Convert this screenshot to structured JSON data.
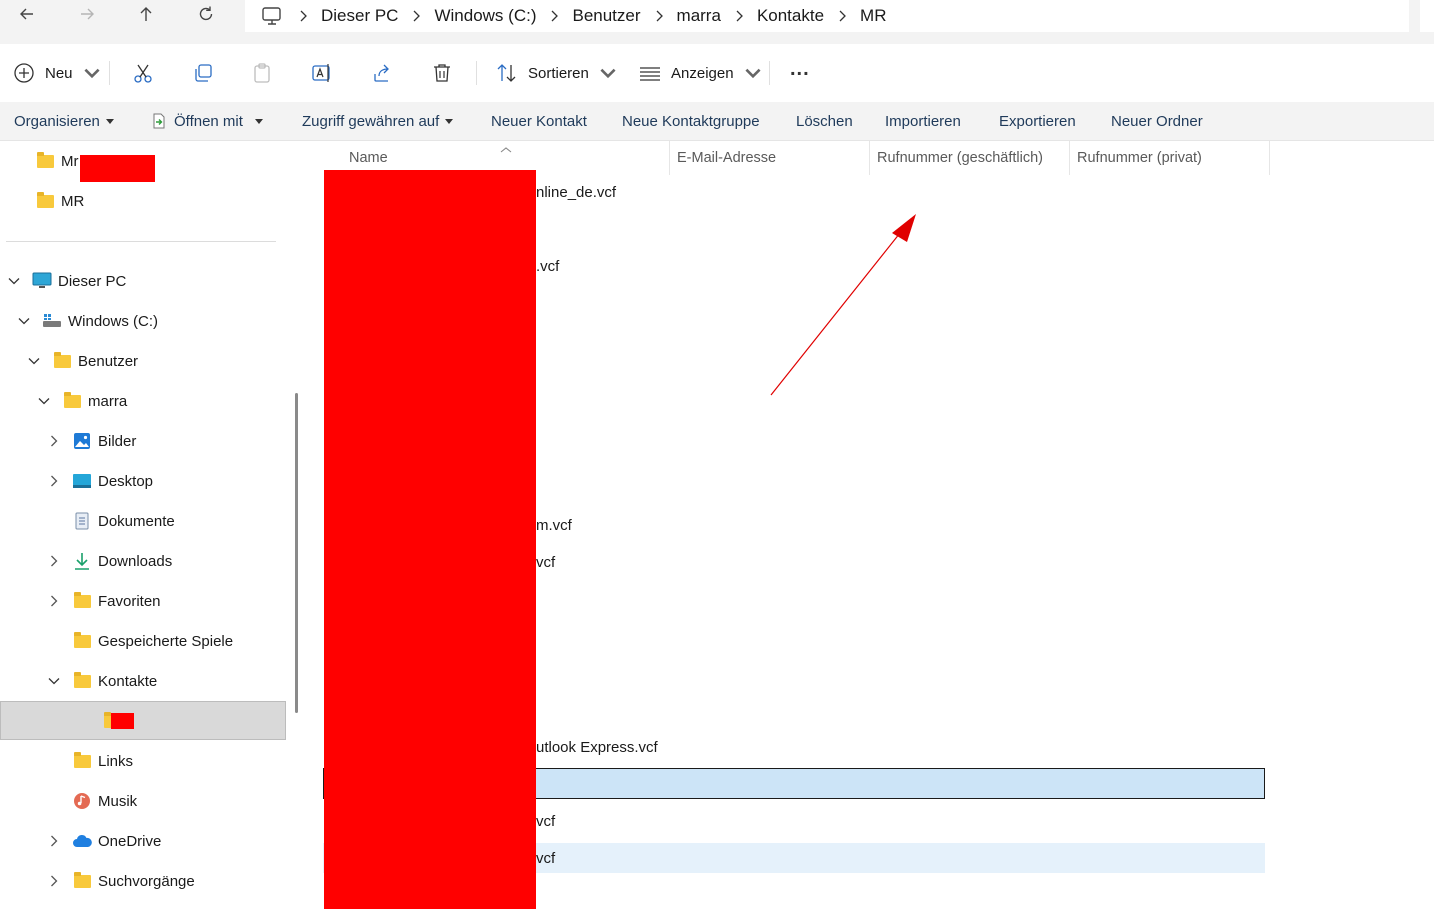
{
  "breadcrumb": [
    "Dieser PC",
    "Windows (C:)",
    "Benutzer",
    "marra",
    "Kontakte",
    "MR"
  ],
  "toolbar": {
    "new_label": "Neu",
    "sort_label": "Sortieren",
    "view_label": "Anzeigen",
    "more_label": "..."
  },
  "ribbon": [
    "Organisieren",
    "Öffnen mit",
    "Zugriff gewähren auf",
    "Neuer Kontakt",
    "Neue Kontaktgruppe",
    "Löschen",
    "Importieren",
    "Exportieren",
    "Neuer Ordner"
  ],
  "nav": {
    "quick": [
      "Mr",
      "MR"
    ],
    "tree": [
      "Dieser PC",
      "Windows (C:)",
      "Benutzer",
      "marra",
      "Bilder",
      "Desktop",
      "Dokumente",
      "Downloads",
      "Favoriten",
      "Gespeicherte Spiele",
      "Kontakte",
      "Links",
      "Musik",
      "OneDrive",
      "Suchvorgänge"
    ]
  },
  "columns": [
    "Name",
    "E-Mail-Adresse",
    "Rufnummer (geschäftlich)",
    "Rufnummer (privat)"
  ],
  "files": [
    "nline_de.vcf",
    ".vcf",
    "m.vcf",
    "vcf",
    "utlook Express.vcf",
    "vcf",
    "vcf"
  ],
  "colors": {
    "redaction": "#ff0000",
    "selection": "#cce4f7",
    "hover": "#e5f1fb",
    "arrow": "#e00000"
  }
}
